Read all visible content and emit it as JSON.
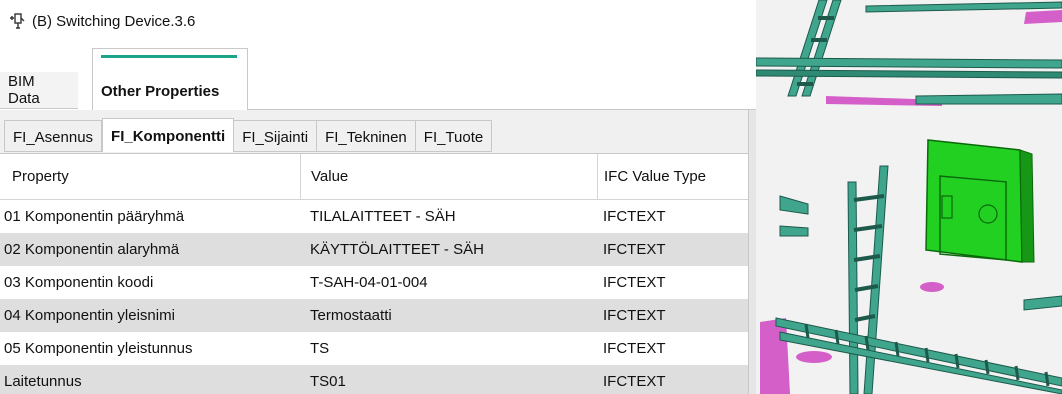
{
  "window": {
    "title": "(B) Switching Device.3.6",
    "icon": "switching-device-icon"
  },
  "main_tabs": [
    {
      "label": "BIM Data",
      "active": false
    },
    {
      "label": "Other Properties",
      "active": true
    }
  ],
  "sub_tabs": [
    {
      "label": "FI_Asennus",
      "active": false
    },
    {
      "label": "FI_Komponentti",
      "active": true
    },
    {
      "label": "FI_Sijainti",
      "active": false
    },
    {
      "label": "FI_Tekninen",
      "active": false
    },
    {
      "label": "FI_Tuote",
      "active": false
    }
  ],
  "table": {
    "headers": [
      "Property",
      "Value",
      "IFC Value Type"
    ],
    "rows": [
      [
        "01 Komponentin pääryhmä",
        "TILALAITTEET - SÄH",
        "IFCTEXT"
      ],
      [
        "02 Komponentin alaryhmä",
        "KÄYTTÖLAITTEET - SÄH",
        "IFCTEXT"
      ],
      [
        "03 Komponentin koodi",
        "T-SAH-04-01-004",
        "IFCTEXT"
      ],
      [
        "04 Komponentin yleisnimi",
        "Termostaatti",
        "IFCTEXT"
      ],
      [
        "05 Komponentin yleistunnus",
        "TS",
        "IFCTEXT"
      ],
      [
        "Laitetunnus",
        "TS01",
        "IFCTEXT"
      ]
    ]
  },
  "colors": {
    "accent": "#1aa58a",
    "model_teal": "#3fa58c",
    "model_magenta": "#d45fc8",
    "selected_green": "#22d022",
    "alt_row": "#dedede"
  }
}
